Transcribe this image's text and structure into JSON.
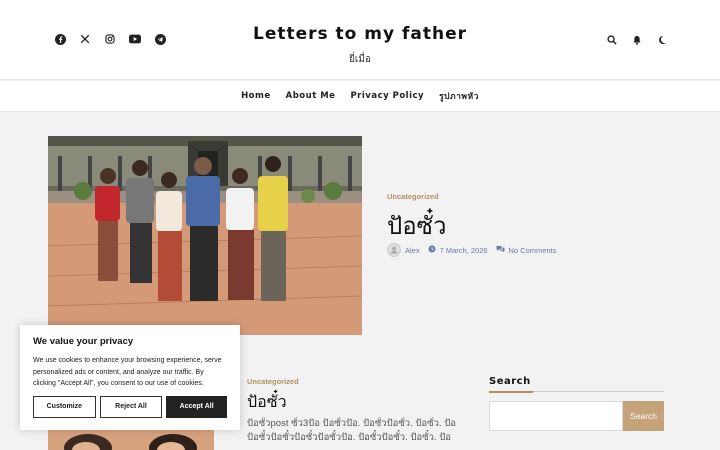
{
  "site": {
    "title": "Letters to my father",
    "tagline": "ยี่เมื่อ"
  },
  "social": [
    "facebook-icon",
    "x-icon",
    "instagram-icon",
    "youtube-icon",
    "telegram-icon"
  ],
  "nav": {
    "items": [
      "Home",
      "About Me",
      "Privacy Policy",
      "รูปภาพหัว"
    ]
  },
  "featured_post": {
    "category": "Uncategorized",
    "title": "ปัอซั๋ว",
    "author": "Alex",
    "date": "7 March, 2026",
    "comments": "No Comments"
  },
  "second_post": {
    "category": "Uncategorized",
    "title": "ปัอซั๋ว",
    "excerpt": "ปัอซั๋วpost ซั๋ว3ปัอ ปัอซั๋วปัอ. ปัอซั๋วปัอซั๋ว. ปัอซั๋ว. ปัอ ปัอซั๋วปัอซั๋วปัอซั๋วปัอซั๋วปัอ. ปัอซั๋วปัอซั๋ว. ปัอซั๋ว. ปัอ"
  },
  "sidebar": {
    "search_heading": "Search",
    "search_placeholder": "",
    "search_button": "Search"
  },
  "cookie_banner": {
    "title": "We value your privacy",
    "text": "We use cookies to enhance your browsing experience, serve personalized ads or content, and analyze our traffic. By clicking \"Accept All\", you consent to our use of cookies.",
    "customize": "Customize",
    "reject": "Reject All",
    "accept": "Accept All"
  },
  "colors": {
    "accent": "#b39063",
    "meta_blue": "#6a7ba1",
    "search_button": "#c4a27a"
  }
}
